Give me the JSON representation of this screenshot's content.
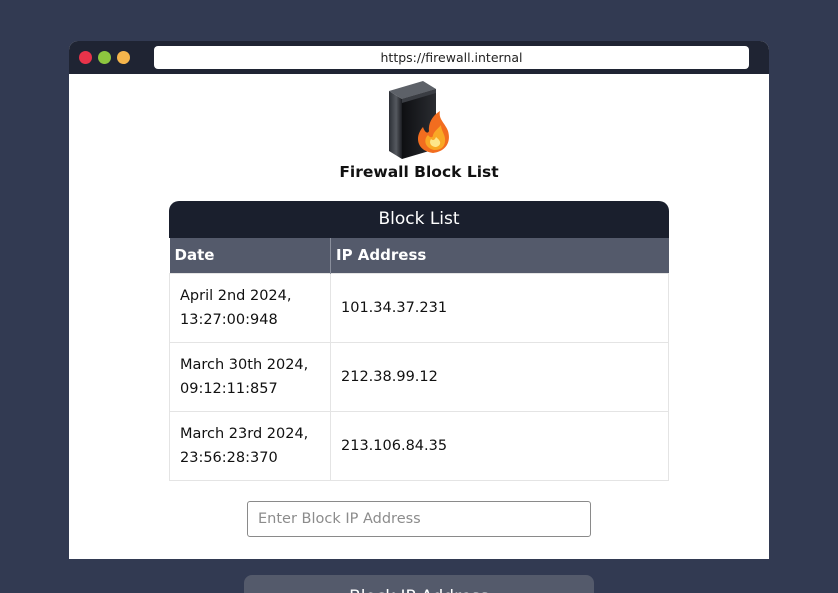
{
  "browser": {
    "url": "https://firewall.internal",
    "dot_colors": [
      "#e8334a",
      "#8dc63f",
      "#f5b54c"
    ]
  },
  "app": {
    "logo_icon": "firewall-server-flame-icon",
    "title": "Firewall Block List"
  },
  "block_list": {
    "header": "Block List",
    "columns": [
      "Date",
      "IP Address"
    ],
    "rows": [
      {
        "date_line1": "April 2nd 2024,",
        "date_line2": "13:27:00:948",
        "ip": "101.34.37.231"
      },
      {
        "date_line1": "March 30th 2024,",
        "date_line2": "09:12:11:857",
        "ip": "212.38.99.12"
      },
      {
        "date_line1": "March 23rd 2024,",
        "date_line2": "23:56:28:370",
        "ip": "213.106.84.35"
      }
    ]
  },
  "form": {
    "input_placeholder": "Enter Block IP Address",
    "input_value": "",
    "button_label": "Block IP Address"
  },
  "colors": {
    "page_background": "#323a52",
    "titlebar": "#1f2433",
    "panel_header": "#1a1f2d",
    "column_header": "#545a6b"
  }
}
